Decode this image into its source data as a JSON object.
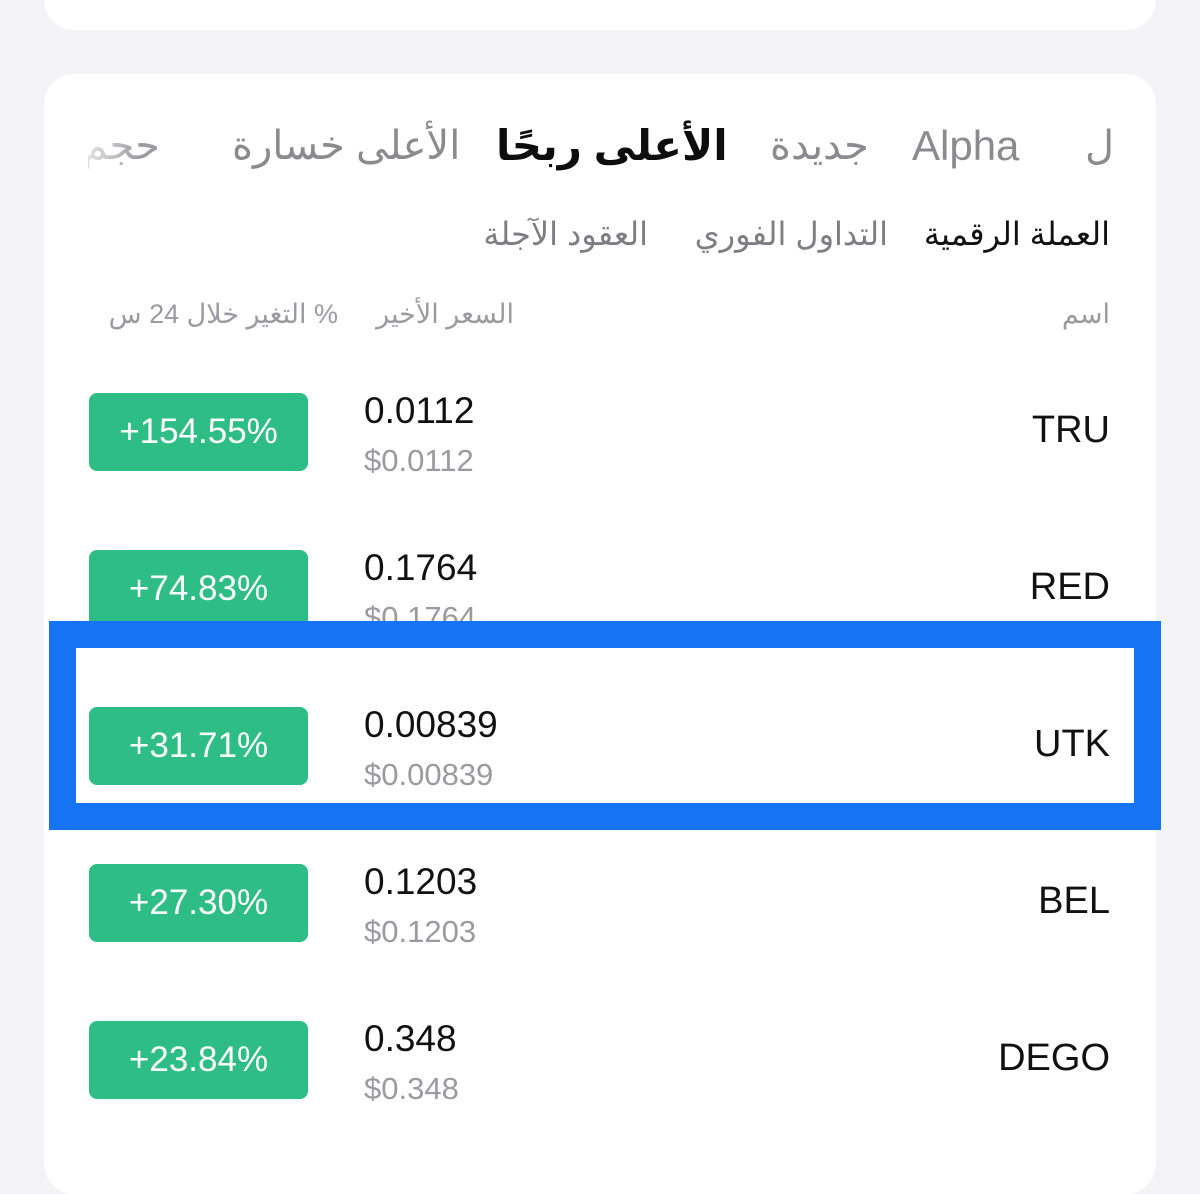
{
  "main_tabs": [
    {
      "label": "ل"
    },
    {
      "label": "Alpha"
    },
    {
      "label": "جديدة"
    },
    {
      "label": "الأعلى ربحًا",
      "active": true
    },
    {
      "label": "الأعلى خسارة"
    },
    {
      "label": "حجم"
    }
  ],
  "sub_tabs": [
    {
      "label": "العملة الرقمية",
      "active": true
    },
    {
      "label": "التداول الفوري"
    },
    {
      "label": "العقود الآجلة"
    }
  ],
  "columns": {
    "name": "اسم",
    "last_price": "السعر الأخير",
    "change_24h": "% التغير خلال 24 س"
  },
  "rows": [
    {
      "symbol": "TRU",
      "price": "0.0112",
      "usd_price": "$0.0112",
      "change": "+154.55%"
    },
    {
      "symbol": "RED",
      "price": "0.1764",
      "usd_price": "$0.1764",
      "change": "+74.83%"
    },
    {
      "symbol": "UTK",
      "price": "0.00839",
      "usd_price": "$0.00839",
      "change": "+31.71%",
      "highlighted": true
    },
    {
      "symbol": "BEL",
      "price": "0.1203",
      "usd_price": "$0.1203",
      "change": "+27.30%"
    },
    {
      "symbol": "DEGO",
      "price": "0.348",
      "usd_price": "$0.348",
      "change": "+23.84%"
    }
  ],
  "colors": {
    "positive": "#2ebd85",
    "highlight": "#1673f2",
    "background": "#f3f3f5"
  }
}
